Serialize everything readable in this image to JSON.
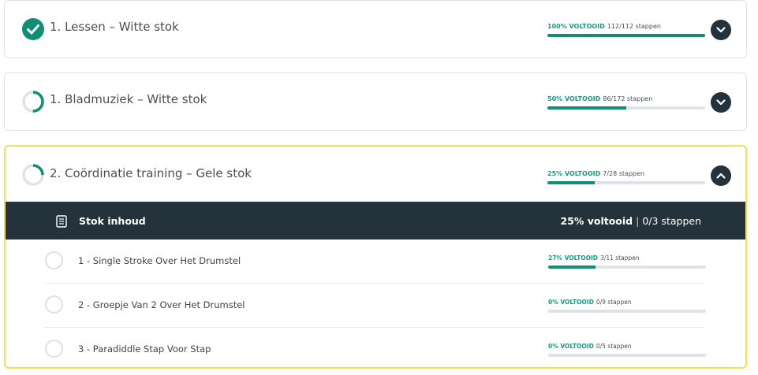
{
  "courses": [
    {
      "title": "1. Lessen – Witte stok",
      "status": "complete",
      "progress_pct_label": "100% VOLTOOID",
      "progress_steps": "112/112 stappen",
      "progress_fraction": 1.0,
      "expanded": false
    },
    {
      "title": "1. Bladmuziek – Witte stok",
      "status": "in-progress",
      "progress_pct_label": "50% VOLTOOID",
      "progress_steps": "86/172 stappen",
      "progress_fraction": 0.5,
      "expanded": false
    },
    {
      "title": "2. Coördinatie training – Gele stok",
      "status": "in-progress",
      "progress_pct_label": "25% VOLTOOID",
      "progress_steps": "7/28 stappen",
      "progress_fraction": 0.25,
      "expanded": true
    }
  ],
  "content": {
    "title": "Stok inhoud",
    "progress_pct": "25% voltooid",
    "progress_steps": "0/3 stappen",
    "lessons": [
      {
        "title": "1 - Single Stroke Over Het Drumstel",
        "pct_label": "27% VOLTOOID",
        "steps": "3/11 stappen",
        "fraction": 0.27
      },
      {
        "title": "2 - Groepje Van 2 Over Het Drumstel",
        "pct_label": "0% VOLTOOID",
        "steps": "0/9 stappen",
        "fraction": 0
      },
      {
        "title": "3 - Paradiddle Stap Voor Stap",
        "pct_label": "0% VOLTOOID",
        "steps": "0/5 stappen",
        "fraction": 0
      }
    ]
  },
  "colors": {
    "accent_green": "#0f8f74",
    "dark": "#23323b",
    "active_border": "#f5e14a"
  }
}
